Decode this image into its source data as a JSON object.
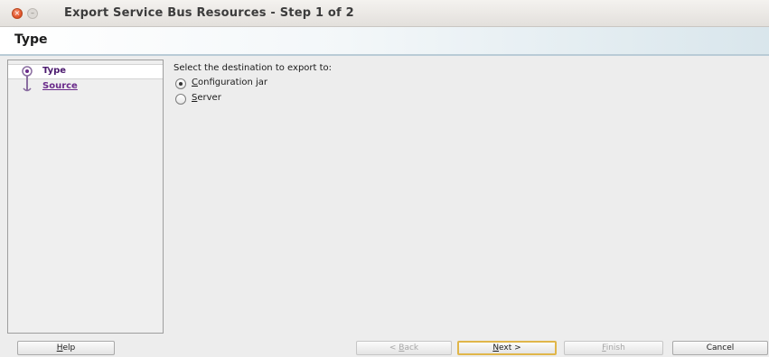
{
  "window": {
    "title": "Export Service Bus Resources - Step 1 of 2",
    "close_glyph": "×",
    "minimize_glyph": "–"
  },
  "header": {
    "title": "Type"
  },
  "nav": {
    "items": [
      {
        "label": "Type",
        "state": "current"
      },
      {
        "label": "Source",
        "state": "link"
      }
    ]
  },
  "main": {
    "prompt": "Select the destination to export to:",
    "options": [
      {
        "mnemonic": "C",
        "rest": "onfiguration jar",
        "selected": true
      },
      {
        "mnemonic": "S",
        "rest": "erver",
        "selected": false
      }
    ]
  },
  "buttons": {
    "help": {
      "mnemonic": "H",
      "rest": "elp"
    },
    "back": {
      "prefix": "< ",
      "mnemonic": "B",
      "rest": "ack"
    },
    "next": {
      "mnemonic": "N",
      "rest": "ext >"
    },
    "finish": {
      "mnemonic": "F",
      "rest": "inish"
    },
    "cancel": {
      "label": "Cancel"
    }
  },
  "colors": {
    "accent_purple": "#6a2a8a",
    "close_orange": "#e4572e",
    "default_button_border": "#e0b64a"
  }
}
